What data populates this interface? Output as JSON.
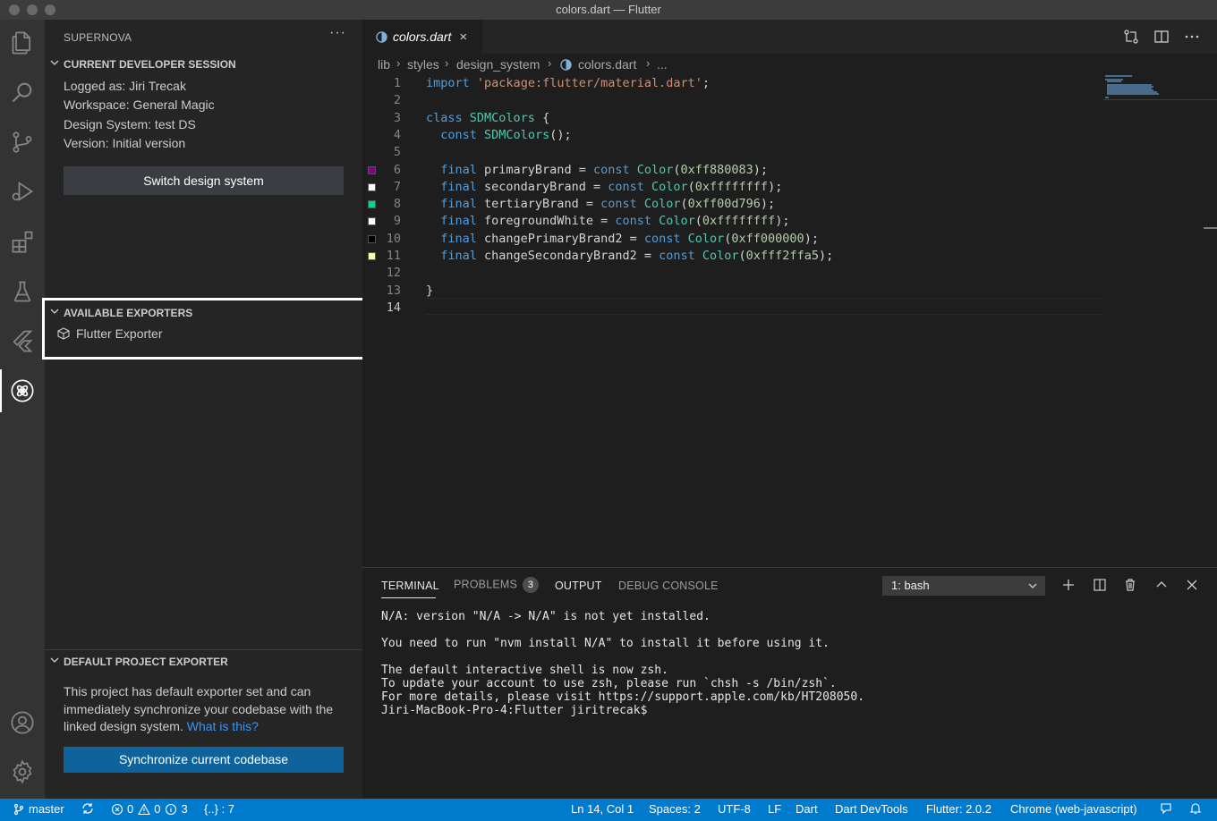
{
  "window": {
    "title": "colors.dart — Flutter"
  },
  "activity_bar": {
    "icons": [
      "explorer-icon",
      "search-icon",
      "source-control-icon",
      "run-debug-icon",
      "extensions-icon",
      "testing-icon",
      "flutter-icon",
      "supernova-icon",
      "account-icon",
      "settings-gear-icon"
    ],
    "active": "supernova-icon"
  },
  "sidebar": {
    "title": "SUPERNOVA",
    "more": "···",
    "session": {
      "header": "CURRENT DEVELOPER SESSION",
      "logged_as": "Logged as: Jiri Trecak",
      "workspace": "Workspace: General Magic",
      "design_system": "Design System: test DS",
      "version": "Version: Initial version",
      "switch_button": "Switch design system"
    },
    "exporters": {
      "header": "AVAILABLE EXPORTERS",
      "items": [
        "Flutter Exporter"
      ]
    },
    "default_exporter": {
      "header": "DEFAULT PROJECT EXPORTER",
      "text": "This project has default exporter set and can immediately synchronize your codebase with the linked design system.",
      "link": "What is this?",
      "sync_button": "Synchronize current codebase"
    }
  },
  "editor": {
    "tab": {
      "name": "colors.dart",
      "close": "×"
    },
    "breadcrumbs": [
      "lib",
      "styles",
      "design_system",
      "colors.dart",
      "..."
    ],
    "current_line": 14,
    "lines": [
      {
        "n": "1",
        "tokens": [
          [
            "kw",
            "import"
          ],
          [
            "",
            " "
          ],
          [
            "str",
            "'package:flutter/material.dart'"
          ],
          [
            "",
            ";"
          ]
        ]
      },
      {
        "n": "2",
        "tokens": []
      },
      {
        "n": "3",
        "tokens": [
          [
            "kw",
            "class"
          ],
          [
            "",
            " "
          ],
          [
            "cls",
            "SDMColors"
          ],
          [
            "",
            " {"
          ]
        ]
      },
      {
        "n": "4",
        "tokens": [
          [
            "",
            "  "
          ],
          [
            "kw",
            "const"
          ],
          [
            "",
            " "
          ],
          [
            "cls",
            "SDMColors"
          ],
          [
            "",
            "();"
          ]
        ]
      },
      {
        "n": "5",
        "tokens": []
      },
      {
        "n": "6",
        "swatch": "#880083",
        "tokens": [
          [
            "",
            "  "
          ],
          [
            "kw",
            "final"
          ],
          [
            "",
            " primaryBrand = "
          ],
          [
            "kw",
            "const"
          ],
          [
            "",
            " "
          ],
          [
            "cls",
            "Color"
          ],
          [
            "",
            "("
          ],
          [
            "num",
            "0xff880083"
          ],
          [
            "",
            ");"
          ]
        ]
      },
      {
        "n": "7",
        "swatch": "#ffffff",
        "tokens": [
          [
            "",
            "  "
          ],
          [
            "kw",
            "final"
          ],
          [
            "",
            " secondaryBrand = "
          ],
          [
            "kw",
            "const"
          ],
          [
            "",
            " "
          ],
          [
            "cls",
            "Color"
          ],
          [
            "",
            "("
          ],
          [
            "num",
            "0xffffffff"
          ],
          [
            "",
            ");"
          ]
        ]
      },
      {
        "n": "8",
        "swatch": "#00d796",
        "tokens": [
          [
            "",
            "  "
          ],
          [
            "kw",
            "final"
          ],
          [
            "",
            " tertiaryBrand = "
          ],
          [
            "kw",
            "const"
          ],
          [
            "",
            " "
          ],
          [
            "cls",
            "Color"
          ],
          [
            "",
            "("
          ],
          [
            "num",
            "0xff00d796"
          ],
          [
            "",
            ");"
          ]
        ]
      },
      {
        "n": "9",
        "swatch": "#ffffff",
        "tokens": [
          [
            "",
            "  "
          ],
          [
            "kw",
            "final"
          ],
          [
            "",
            " foregroundWhite = "
          ],
          [
            "kw",
            "const"
          ],
          [
            "",
            " "
          ],
          [
            "cls",
            "Color"
          ],
          [
            "",
            "("
          ],
          [
            "num",
            "0xffffffff"
          ],
          [
            "",
            ");"
          ]
        ]
      },
      {
        "n": "10",
        "swatch": "#000000",
        "tokens": [
          [
            "",
            "  "
          ],
          [
            "kw",
            "final"
          ],
          [
            "",
            " changePrimaryBrand2 = "
          ],
          [
            "kw",
            "const"
          ],
          [
            "",
            " "
          ],
          [
            "cls",
            "Color"
          ],
          [
            "",
            "("
          ],
          [
            "num",
            "0xff000000"
          ],
          [
            "",
            ");"
          ]
        ]
      },
      {
        "n": "11",
        "swatch": "#fff2ffa5",
        "tokens": [
          [
            "",
            "  "
          ],
          [
            "kw",
            "final"
          ],
          [
            "",
            " changeSecondaryBrand2 = "
          ],
          [
            "kw",
            "const"
          ],
          [
            "",
            " "
          ],
          [
            "cls",
            "Color"
          ],
          [
            "",
            "("
          ],
          [
            "num",
            "0xfff2ffa5"
          ],
          [
            "",
            ");"
          ]
        ]
      },
      {
        "n": "12",
        "tokens": []
      },
      {
        "n": "13",
        "tokens": [
          [
            "",
            "}"
          ]
        ]
      },
      {
        "n": "14",
        "tokens": []
      }
    ]
  },
  "panel": {
    "tabs": [
      "TERMINAL",
      "PROBLEMS",
      "OUTPUT",
      "DEBUG CONSOLE"
    ],
    "active_tab": "TERMINAL",
    "problems_count": "3",
    "shell": "1: bash",
    "terminal_lines": [
      "N/A: version \"N/A -> N/A\" is not yet installed.",
      "",
      "You need to run \"nvm install N/A\" to install it before using it.",
      "",
      "The default interactive shell is now zsh.",
      "To update your account to use zsh, please run `chsh -s /bin/zsh`.",
      "For more details, please visit https://support.apple.com/kb/HT208050.",
      "Jiri-MacBook-Pro-4:Flutter jiritrecak$"
    ]
  },
  "statusbar": {
    "branch": "master",
    "errors": "0",
    "warnings": "0",
    "infos": "3",
    "outline": "{..} : 7",
    "position": "Ln 14, Col 1",
    "spaces": "Spaces: 2",
    "encoding": "UTF-8",
    "eol": "LF",
    "language": "Dart",
    "devtools": "Dart DevTools",
    "flutter": "Flutter: 2.0.2",
    "device": "Chrome (web-javascript)"
  },
  "colors": {
    "accent": "#007acc",
    "button_blue": "#0e639c",
    "link": "#3794ff"
  }
}
